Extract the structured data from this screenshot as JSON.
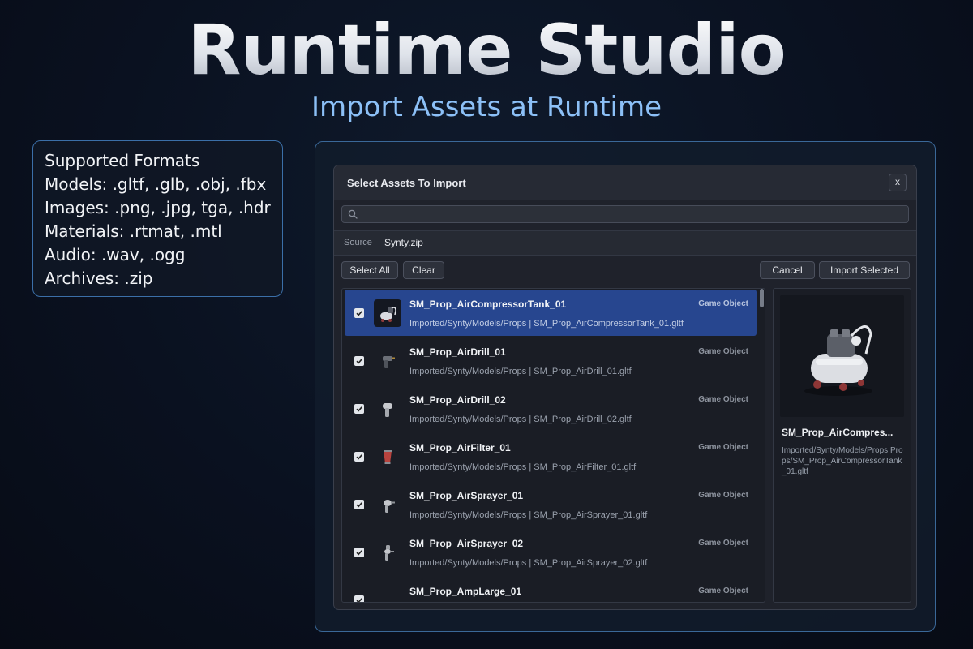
{
  "hero": {
    "title": "Runtime Studio",
    "subtitle": "Import Assets at Runtime"
  },
  "formats": {
    "lines": [
      "Supported Formats",
      "Models: .gltf, .glb, .obj, .fbx",
      "Images: .png, .jpg, tga, .hdr",
      "Materials: .rtmat, .mtl",
      "Audio: .wav, .ogg",
      "Archives: .zip"
    ]
  },
  "dialog": {
    "title": "Select Assets To Import",
    "close_label": "x",
    "search": {
      "value": "",
      "placeholder": ""
    },
    "source_label": "Source",
    "source_value": "Synty.zip",
    "buttons": {
      "select_all": "Select All",
      "clear": "Clear",
      "cancel": "Cancel",
      "import_selected": "Import Selected"
    },
    "items": [
      {
        "name": "SM_Prop_AirCompressorTank_01",
        "path": "Imported/Synty/Models/Props | SM_Prop_AirCompressorTank_01.gltf",
        "type": "Game Object",
        "checked": true,
        "selected": true,
        "icon": "air-compressor-icon"
      },
      {
        "name": "SM_Prop_AirDrill_01",
        "path": "Imported/Synty/Models/Props | SM_Prop_AirDrill_01.gltf",
        "type": "Game Object",
        "checked": true,
        "selected": false,
        "icon": "air-drill-icon"
      },
      {
        "name": "SM_Prop_AirDrill_02",
        "path": "Imported/Synty/Models/Props | SM_Prop_AirDrill_02.gltf",
        "type": "Game Object",
        "checked": true,
        "selected": false,
        "icon": "air-drill-icon"
      },
      {
        "name": "SM_Prop_AirFilter_01",
        "path": "Imported/Synty/Models/Props | SM_Prop_AirFilter_01.gltf",
        "type": "Game Object",
        "checked": true,
        "selected": false,
        "icon": "air-filter-icon"
      },
      {
        "name": "SM_Prop_AirSprayer_01",
        "path": "Imported/Synty/Models/Props | SM_Prop_AirSprayer_01.gltf",
        "type": "Game Object",
        "checked": true,
        "selected": false,
        "icon": "air-sprayer-icon"
      },
      {
        "name": "SM_Prop_AirSprayer_02",
        "path": "Imported/Synty/Models/Props | SM_Prop_AirSprayer_02.gltf",
        "type": "Game Object",
        "checked": true,
        "selected": false,
        "icon": "air-sprayer-icon"
      },
      {
        "name": "SM_Prop_AmpLarge_01",
        "path": "",
        "type": "Game Object",
        "checked": true,
        "selected": false,
        "icon": "amp-icon"
      }
    ],
    "preview": {
      "name": "SM_Prop_AirCompres...",
      "path": "Imported/Synty/Models/Props Props/SM_Prop_AirCompressorTank_01.gltf",
      "icon": "air-compressor-icon"
    }
  }
}
